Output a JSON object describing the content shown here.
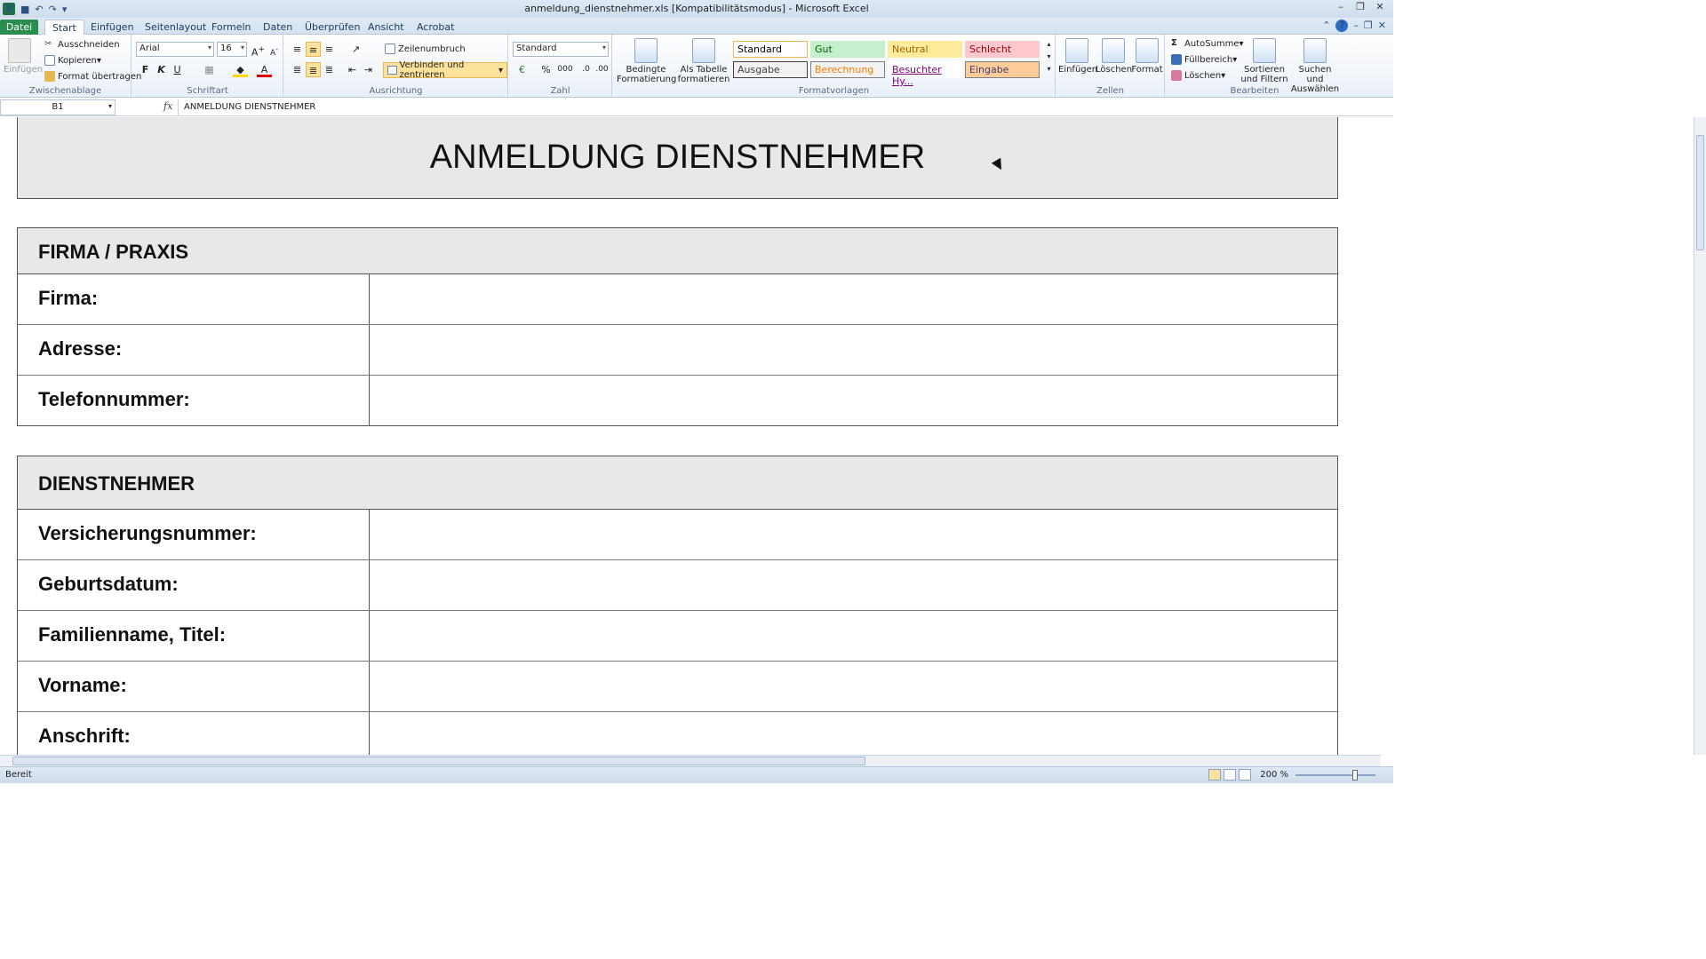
{
  "window": {
    "title": "anmeldung_dienstnehmer.xls  [Kompatibilitätsmodus]  -  Microsoft Excel"
  },
  "tabs": [
    "Datei",
    "Start",
    "Einfügen",
    "Seitenlayout",
    "Formeln",
    "Daten",
    "Überprüfen",
    "Ansicht",
    "Acrobat"
  ],
  "ribbon": {
    "clipboard": {
      "label": "Zwischenablage",
      "paste": "Einfügen",
      "cut": "Ausschneiden",
      "copy": "Kopieren",
      "format_painter": "Format übertragen"
    },
    "font": {
      "label": "Schriftart",
      "name": "Arial",
      "size": "16",
      "bold": "F",
      "italic": "K",
      "underline": "U"
    },
    "alignment": {
      "label": "Ausrichtung",
      "wrap": "Zeilenumbruch",
      "merge": "Verbinden und zentrieren"
    },
    "number": {
      "label": "Zahl",
      "format": "Standard",
      "percent": "%",
      "thousands": "000"
    },
    "styles": {
      "label": "Formatvorlagen",
      "conditional": "Bedingte Formatierung",
      "as_table": "Als Tabelle formatieren",
      "cells": [
        {
          "name": "Standard",
          "bg": "#ffffff",
          "fg": "#000000",
          "border": "#e6b854"
        },
        {
          "name": "Gut",
          "bg": "#c6efce",
          "fg": "#006100",
          "border": "#c6efce"
        },
        {
          "name": "Neutral",
          "bg": "#ffeb9c",
          "fg": "#9c6500",
          "border": "#ffeb9c"
        },
        {
          "name": "Schlecht",
          "bg": "#ffc7ce",
          "fg": "#9c0006",
          "border": "#ffc7ce"
        },
        {
          "name": "Ausgabe",
          "bg": "#f2f2f2",
          "fg": "#3f3f3f",
          "border": "#3f3f3f"
        },
        {
          "name": "Berechnung",
          "bg": "#f2f2f2",
          "fg": "#fa7d00",
          "border": "#7f7f7f"
        },
        {
          "name": "Besuchter Hy...",
          "bg": "#ffffff",
          "fg": "#800080",
          "border": "#ffffff"
        },
        {
          "name": "Eingabe",
          "bg": "#ffcc99",
          "fg": "#3f3f76",
          "border": "#7f7f7f"
        }
      ]
    },
    "cells": {
      "label": "Zellen",
      "insert": "Einfügen",
      "delete": "Löschen",
      "format": "Format"
    },
    "editing": {
      "label": "Bearbeiten",
      "autosum": "AutoSumme",
      "fill": "Füllbereich",
      "clear": "Löschen",
      "sort": "Sortieren und Filtern",
      "find": "Suchen und Auswählen"
    }
  },
  "formula_bar": {
    "name_box": "B1",
    "fx": "fx",
    "value": "ANMELDUNG DIENSTNEHMER"
  },
  "sheet": {
    "title": "ANMELDUNG DIENSTNEHMER",
    "sections": [
      {
        "title": "FIRMA / PRAXIS",
        "fields": [
          "Firma:",
          "Adresse:",
          "Telefonnummer:"
        ]
      },
      {
        "title": "DIENSTNEHMER",
        "fields": [
          "Versicherungsnummer:",
          "Geburtsdatum:",
          "Familienname, Titel:",
          "Vorname:",
          "Anschrift:"
        ]
      }
    ]
  },
  "status": {
    "ready": "Bereit",
    "zoom": "200 %"
  }
}
